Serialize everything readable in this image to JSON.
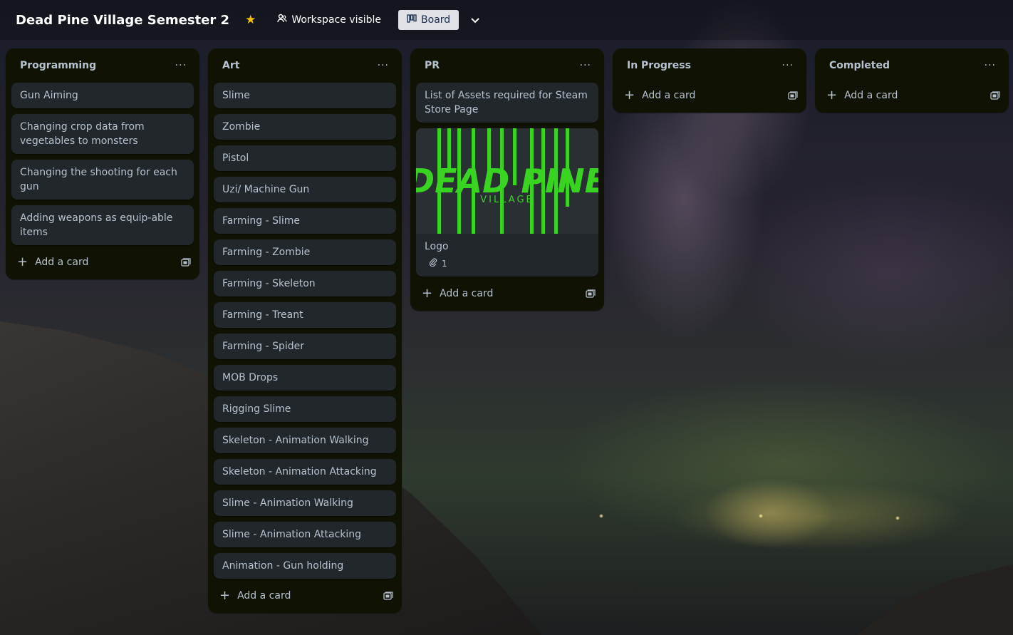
{
  "header": {
    "title": "Dead Pine Village Semester 2",
    "visibility_label": "Workspace visible",
    "view_label": "Board"
  },
  "lists": [
    {
      "title": "Programming",
      "cards": [
        "Gun Aiming",
        "Changing crop data from vegetables to monsters",
        "Changing the shooting for each gun",
        "Adding weapons as equip-able items"
      ],
      "add_label": "Add a card"
    },
    {
      "title": "Art",
      "cards": [
        "Slime",
        "Zombie",
        "Pistol",
        "Uzi/ Machine Gun",
        "Farming - Slime",
        "Farming - Zombie",
        "Farming - Skeleton",
        "Farming - Treant",
        "Farming - Spider",
        "MOB Drops",
        "Rigging Slime",
        "Skeleton - Animation Walking",
        "Skeleton - Animation Attacking",
        "Slime - Animation Walking",
        "Slime - Animation Attacking",
        "Animation - Gun holding"
      ],
      "add_label": "Add a card"
    },
    {
      "title": "PR",
      "cards": [
        "List of Assets required for Steam Store Page"
      ],
      "cover_card": {
        "title": "Logo",
        "attachments": "1",
        "logo_main": "DEAD PINE",
        "logo_sub": "VILLAGE",
        "logo_color": "#39d422"
      },
      "add_label": "Add a card"
    },
    {
      "title": "In Progress",
      "cards": [],
      "add_label": "Add a card"
    },
    {
      "title": "Completed",
      "cards": [],
      "add_label": "Add a card"
    }
  ],
  "colors": {
    "list_bg": "#101204",
    "card_bg": "#22272b",
    "text": "#b6c2cf",
    "star": "#f5c400"
  }
}
